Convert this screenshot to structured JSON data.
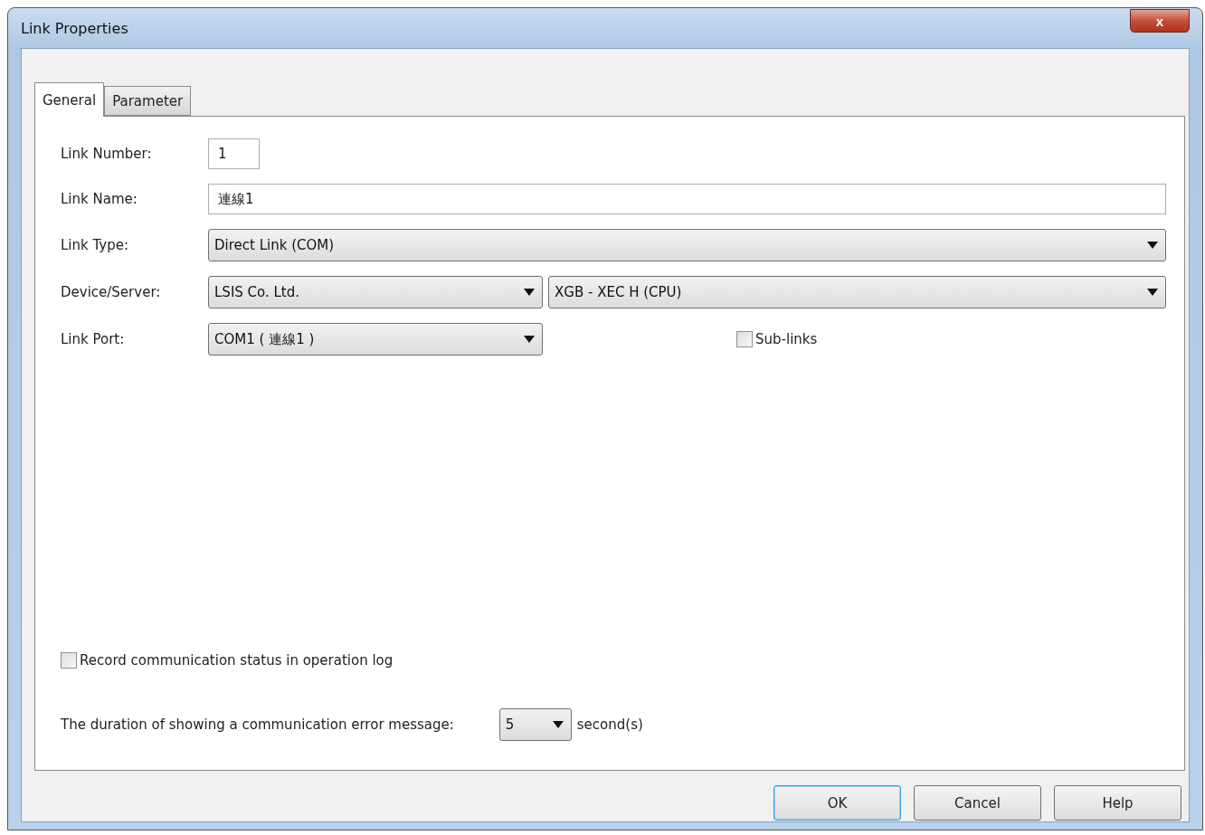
{
  "window": {
    "title": "Link Properties",
    "close": "x"
  },
  "tabs": [
    {
      "label": "General",
      "selected": true
    },
    {
      "label": "Parameter",
      "selected": false
    }
  ],
  "fields": [
    {
      "kind": "short_input",
      "label": "Link Number:",
      "value": "1"
    },
    {
      "kind": "input",
      "label": "Link Name:",
      "value": "連線1"
    },
    {
      "kind": "combo",
      "label": "Link Type:",
      "values": [
        "Direct Link (COM)"
      ]
    },
    {
      "kind": "combo",
      "label": "Device/Server:",
      "values": [
        "LSIS Co. Ltd.",
        "XGB - XEC H (CPU)"
      ]
    },
    {
      "kind": "port",
      "label": "Link Port:",
      "values": [
        "COM1 ( 連線1 )"
      ],
      "checkbox": {
        "label": "Sub-links",
        "checked": false
      }
    }
  ],
  "record_log": {
    "label": "Record communication status in operation log",
    "checked": false
  },
  "duration": {
    "label": "The duration of showing a communication error message:",
    "value": "5",
    "unit": "second(s)"
  },
  "buttons": [
    {
      "label": "OK",
      "default": true
    },
    {
      "label": "Cancel",
      "default": false
    },
    {
      "label": "Help",
      "default": false
    }
  ]
}
